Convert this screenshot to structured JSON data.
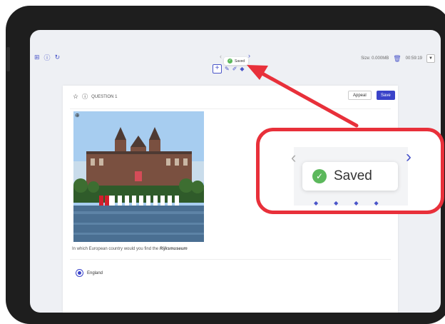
{
  "topbar": {
    "left_icons": [
      "grid-icon",
      "info-icon",
      "refresh-icon"
    ],
    "size_text": "Size: 0.000MB",
    "timer": "00:59:19"
  },
  "save_toast": {
    "text": "Saved"
  },
  "toolbar": {
    "tools": [
      "plus-icon",
      "pen-icon",
      "highlighter-icon",
      "diamond-icon"
    ]
  },
  "question": {
    "number_label": "QUESTION 1",
    "appeal_label": "Appeal",
    "save_label": "Save",
    "prompt_text": "In which European country would you find the",
    "prompt_bold": "Rijksmuseum",
    "options": [
      {
        "label": "England",
        "selected": true
      }
    ]
  },
  "callout": {
    "text": "Saved"
  },
  "colors": {
    "accent": "#3a43c9",
    "callout_border": "#e8303a",
    "success": "#5cb85c"
  }
}
